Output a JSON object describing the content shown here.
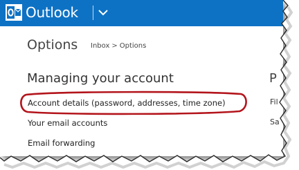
{
  "app": {
    "brand": "Outlook",
    "logo_letter": "O"
  },
  "header": {
    "dropdown_icon": "chevron-down-icon"
  },
  "page": {
    "title": "Options"
  },
  "breadcrumb": {
    "inbox": "Inbox",
    "separator": ">",
    "current": "Options"
  },
  "section": {
    "title": "Managing your account"
  },
  "links": [
    {
      "label": "Account details (password, addresses, time zone)",
      "highlighted": true
    },
    {
      "label": "Your email accounts"
    },
    {
      "label": "Email forwarding"
    }
  ],
  "right_column": {
    "heading": "P",
    "items": [
      "Fil",
      "Sa"
    ]
  },
  "colors": {
    "header_bg": "#0e72c4",
    "highlight_oval": "#b3141b"
  }
}
